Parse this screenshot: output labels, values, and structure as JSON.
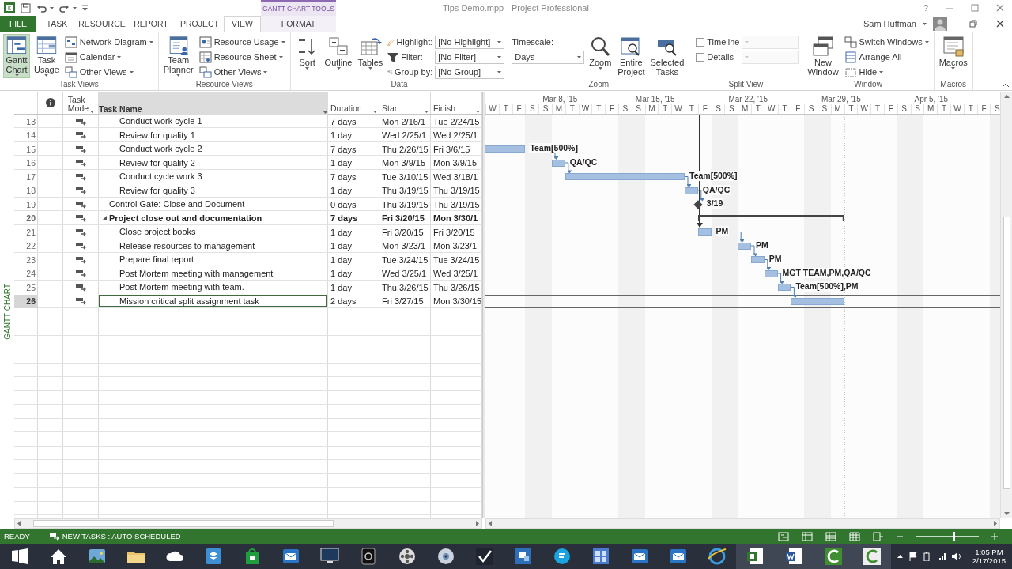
{
  "title_bar": {
    "context_label": "GANTT CHART TOOLS",
    "title": "Tips Demo.mpp - Project Professional",
    "help": "?"
  },
  "tabs": [
    {
      "label": "FILE",
      "kind": "file",
      "selected": false
    },
    {
      "label": "TASK",
      "kind": "normal",
      "selected": false
    },
    {
      "label": "RESOURCE",
      "kind": "normal",
      "selected": false
    },
    {
      "label": "REPORT",
      "kind": "normal",
      "selected": false
    },
    {
      "label": "PROJECT",
      "kind": "normal",
      "selected": false
    },
    {
      "label": "VIEW",
      "kind": "normal",
      "selected": true
    },
    {
      "label": "FORMAT",
      "kind": "contextual",
      "selected": false
    }
  ],
  "user": {
    "name": "Sam Huffman"
  },
  "ribbon": {
    "groups": [
      {
        "label": "Task Views",
        "columns": [
          {
            "kind": "large",
            "label": "Gantt Chart",
            "dropdown": true,
            "selected": true
          },
          {
            "kind": "large",
            "label": "Task Usage",
            "dropdown": true,
            "selected": false
          },
          {
            "kind": "stack",
            "items": [
              {
                "kind": "small",
                "label": "Network Diagram",
                "dropdown": true
              },
              {
                "kind": "small",
                "label": "Calendar",
                "dropdown": true
              },
              {
                "kind": "small",
                "label": "Other Views",
                "dropdown": true
              }
            ]
          }
        ]
      },
      {
        "label": "Resource Views",
        "columns": [
          {
            "kind": "large",
            "label": "Team Planner",
            "dropdown": true,
            "selected": false
          },
          {
            "kind": "stack",
            "items": [
              {
                "kind": "small",
                "label": "Resource Usage",
                "dropdown": true
              },
              {
                "kind": "small",
                "label": "Resource Sheet",
                "dropdown": true
              },
              {
                "kind": "small",
                "label": "Other Views",
                "dropdown": true
              }
            ]
          }
        ]
      },
      {
        "label": "Data",
        "columns": [
          {
            "kind": "large",
            "label": "Sort",
            "dropdown": true
          },
          {
            "kind": "large",
            "label": "Outline",
            "dropdown": true
          },
          {
            "kind": "large",
            "label": "Tables",
            "dropdown": true
          },
          {
            "kind": "stack",
            "items": [
              {
                "kind": "combo",
                "label": "Highlight:",
                "value": "[No Highlight]"
              },
              {
                "kind": "combo",
                "label": "Filter:",
                "value": "[No Filter]"
              },
              {
                "kind": "combo",
                "label": "Group by:",
                "value": "[No Group]"
              }
            ]
          }
        ]
      },
      {
        "label": "Zoom",
        "columns": [
          {
            "kind": "stack",
            "items": [
              {
                "kind": "caption",
                "label": "Timescale:"
              },
              {
                "kind": "select",
                "value": "Days"
              }
            ]
          },
          {
            "kind": "large",
            "label": "Zoom",
            "dropdown": true
          },
          {
            "kind": "large",
            "label": "Entire Project",
            "dropdown": false
          },
          {
            "kind": "large",
            "label": "Selected Tasks",
            "dropdown": false
          }
        ]
      },
      {
        "label": "Split View",
        "columns": [
          {
            "kind": "stack",
            "items": [
              {
                "kind": "checkbox",
                "label": "Timeline",
                "checked": false
              },
              {
                "kind": "checkbox",
                "label": "Details",
                "checked": false
              }
            ]
          },
          {
            "kind": "stack",
            "items": [
              {
                "kind": "empty_select",
                "disabled": true
              },
              {
                "kind": "empty_select",
                "disabled": true
              }
            ]
          }
        ]
      },
      {
        "label": "Window",
        "columns": [
          {
            "kind": "large",
            "label": "New Window",
            "dropdown": false
          },
          {
            "kind": "stack",
            "items": [
              {
                "kind": "small",
                "label": "Switch Windows",
                "dropdown": true
              },
              {
                "kind": "small",
                "label": "Arrange All",
                "dropdown": false
              },
              {
                "kind": "small",
                "label": "Hide",
                "dropdown": true
              }
            ]
          }
        ]
      },
      {
        "label": "Macros",
        "columns": [
          {
            "kind": "large",
            "label": "Macros",
            "dropdown": true
          }
        ]
      }
    ]
  },
  "view_label": "GANTT CHART",
  "columns": [
    {
      "label": "Task Mode",
      "selected": false
    },
    {
      "label": "Task Name",
      "selected": true
    },
    {
      "label": "Duration",
      "selected": false
    },
    {
      "label": "Start",
      "selected": false
    },
    {
      "label": "Finish",
      "selected": false
    }
  ],
  "timescale": {
    "weeks": [
      "Mar 8, '15",
      "Mar 15, '15",
      "Mar 22, '15",
      "Mar 29, '15",
      "Apr 5, '15"
    ],
    "days": [
      "W",
      "T",
      "F",
      "S",
      "S",
      "M",
      "T",
      "W",
      "T",
      "F",
      "S",
      "S",
      "M",
      "T",
      "W",
      "T",
      "F",
      "S",
      "S",
      "M",
      "T",
      "W",
      "T",
      "F",
      "S",
      "S",
      "M",
      "T",
      "W",
      "T",
      "F",
      "S",
      "S",
      "M",
      "T",
      "W",
      "T",
      "F",
      "S"
    ]
  },
  "tasks": [
    {
      "kind": "offscreen_parent",
      "children": [
        {
          "kind": "task",
          "id": "13",
          "name": "Conduct work cycle 1",
          "duration": "7 days",
          "start": "Mon 2/16/1",
          "finish": "Tue 2/24/15",
          "selected": false
        },
        {
          "kind": "task",
          "id": "14",
          "name": "Review for quality 1",
          "duration": "1 day",
          "start": "Wed 2/25/1",
          "finish": "Wed 2/25/1",
          "selected": false
        },
        {
          "kind": "task",
          "id": "15",
          "name": "Conduct work cycle 2",
          "duration": "7 days",
          "start": "Thu 2/26/15",
          "finish": "Fri 3/6/15",
          "bar_label": "Team[500%]",
          "selected": false
        },
        {
          "kind": "task",
          "id": "16",
          "name": "Review for quality 2",
          "duration": "1 day",
          "start": "Mon 3/9/15",
          "finish": "Mon 3/9/15",
          "bar_label": "QA/QC",
          "selected": false
        },
        {
          "kind": "task",
          "id": "17",
          "name": "Conduct cycle work 3",
          "duration": "7 days",
          "start": "Tue 3/10/15",
          "finish": "Wed 3/18/1",
          "bar_label": "Team[500%]",
          "selected": false
        },
        {
          "kind": "task",
          "id": "18",
          "name": "Review for quality 3",
          "duration": "1 day",
          "start": "Thu 3/19/15",
          "finish": "Thu 3/19/15",
          "bar_label": "QA/QC",
          "selected": false
        }
      ]
    },
    {
      "kind": "milestone",
      "id": "19",
      "name": "Control Gate: Close and Document",
      "duration": "0 days",
      "start": "Thu 3/19/15",
      "finish": "Thu 3/19/15",
      "bar_label": "3/19",
      "selected": false
    },
    {
      "kind": "summary",
      "id": "20",
      "name": "Project close out and documentation",
      "duration": "7 days",
      "start": "Fri 3/20/15",
      "finish": "Mon 3/30/1",
      "expanded": true,
      "selected": false,
      "children": [
        {
          "kind": "task",
          "id": "21",
          "name": "Close project books",
          "duration": "1 day",
          "start": "Fri 3/20/15",
          "finish": "Fri 3/20/15",
          "bar_label": "PM",
          "selected": false
        },
        {
          "kind": "task",
          "id": "22",
          "name": "Release resources to management",
          "duration": "1 day",
          "start": "Mon 3/23/1",
          "finish": "Mon 3/23/1",
          "bar_label": "PM",
          "selected": false
        },
        {
          "kind": "task",
          "id": "23",
          "name": "Prepare final report",
          "duration": "1 day",
          "start": "Tue 3/24/15",
          "finish": "Tue 3/24/15",
          "bar_label": "PM",
          "selected": false
        },
        {
          "kind": "task",
          "id": "24",
          "name": "Post Mortem meeting with management",
          "duration": "1 day",
          "start": "Wed 3/25/1",
          "finish": "Wed 3/25/1",
          "bar_label": "MGT TEAM,PM,QA/QC",
          "selected": false
        },
        {
          "kind": "task",
          "id": "25",
          "name": "Post Mortem meeting with team.",
          "duration": "1 day",
          "start": "Thu 3/26/15",
          "finish": "Thu 3/26/15",
          "bar_label": "Team[500%],PM",
          "selected": false
        },
        {
          "kind": "task",
          "id": "26",
          "name": "Mission critical split assignment task",
          "duration": "2 days",
          "start": "Fri 3/27/15",
          "finish": "Mon 3/30/15",
          "selected": true
        }
      ]
    }
  ],
  "status_bar": {
    "ready": "READY",
    "new_tasks": "NEW TASKS : AUTO SCHEDULED",
    "zoom_slider": {
      "level": 0.6
    }
  },
  "taskbar": {
    "apps": [
      {
        "kind": "home",
        "open": false
      },
      {
        "kind": "photo",
        "open": false
      },
      {
        "kind": "folder",
        "open": false
      },
      {
        "kind": "cloud",
        "open": false
      },
      {
        "kind": "box",
        "open": false
      },
      {
        "kind": "bag",
        "open": false
      },
      {
        "kind": "envelope",
        "open": false
      },
      {
        "kind": "monitor",
        "open": false
      },
      {
        "kind": "camera",
        "open": false
      },
      {
        "kind": "reel",
        "open": false
      },
      {
        "kind": "disc",
        "open": false
      },
      {
        "kind": "check",
        "open": false
      },
      {
        "kind": "chat",
        "open": false
      },
      {
        "kind": "bubble",
        "open": false
      },
      {
        "kind": "tiles",
        "open": false
      },
      {
        "kind": "envelope",
        "open": false
      },
      {
        "kind": "envelope",
        "open": false
      },
      {
        "kind": "globe",
        "open": false
      },
      {
        "kind": "document_green",
        "open": true
      },
      {
        "kind": "document_blue",
        "open": true
      },
      {
        "kind": "arc_green",
        "open": true
      },
      {
        "kind": "arc_white",
        "open": true
      }
    ],
    "clock": {
      "time": "1:05 PM",
      "date": "2/17/2015"
    }
  }
}
